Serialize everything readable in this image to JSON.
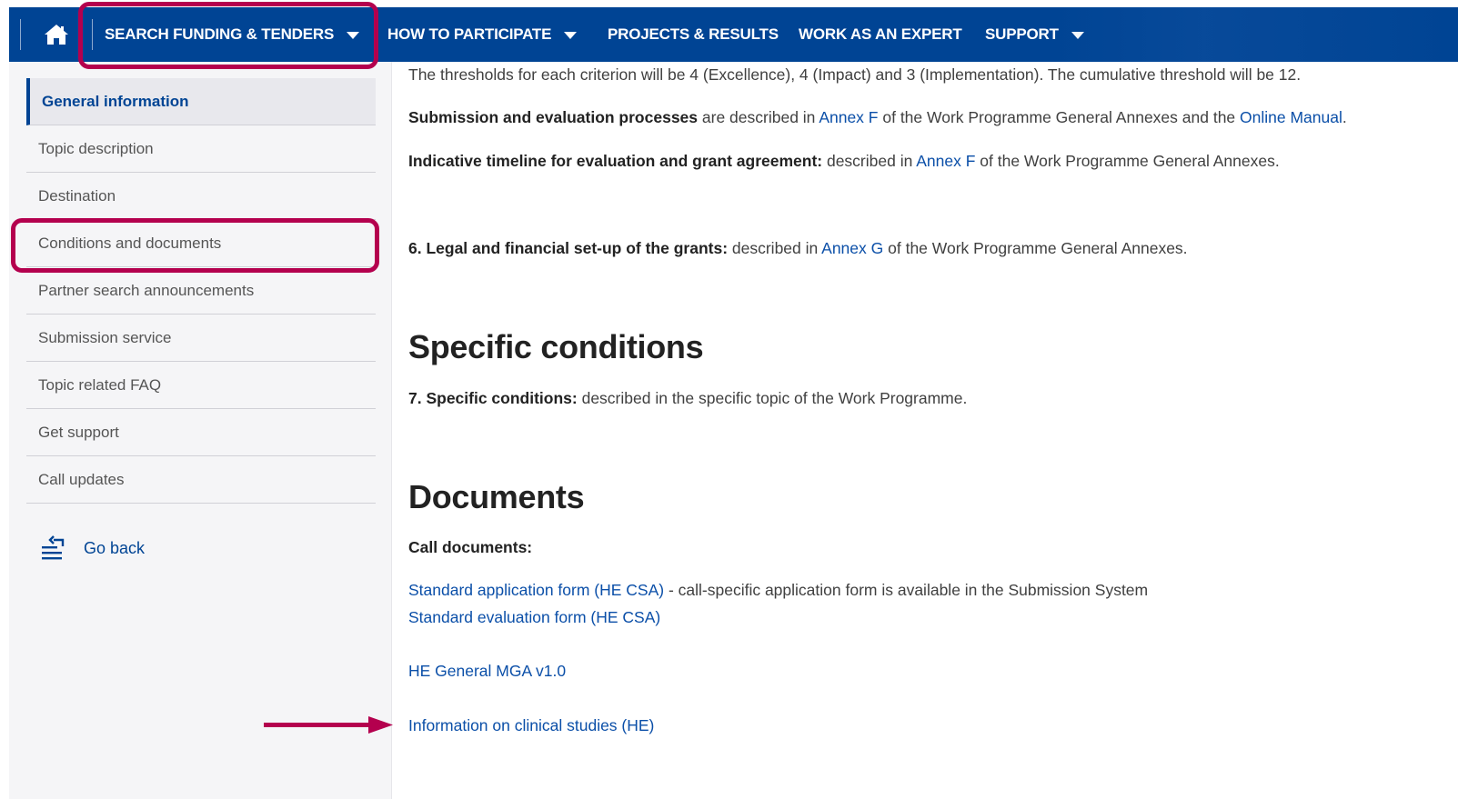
{
  "nav": {
    "items": [
      {
        "label": "SEARCH FUNDING & TENDERS"
      },
      {
        "label": "HOW TO PARTICIPATE"
      },
      {
        "label": "PROJECTS & RESULTS"
      },
      {
        "label": "WORK AS AN EXPERT"
      },
      {
        "label": "SUPPORT"
      }
    ],
    "home_icon": "home-icon",
    "caret_icon": "caret-down-icon",
    "background": "#004494"
  },
  "sidebar": {
    "items": [
      {
        "label": "General information"
      },
      {
        "label": "Topic description"
      },
      {
        "label": "Destination"
      },
      {
        "label": "Conditions and documents"
      },
      {
        "label": "Partner search announcements"
      },
      {
        "label": "Submission service"
      },
      {
        "label": "Topic related FAQ"
      },
      {
        "label": "Get support"
      },
      {
        "label": "Call updates"
      }
    ],
    "go_back": {
      "label": "Go back",
      "icon": "list-back-icon"
    }
  },
  "content": {
    "thresholds": "The thresholds for each criterion will be 4 (Excellence), 4 (Impact) and 3 (Implementation). The cumulative threshold will be 12.",
    "submission": {
      "bold": "Submission and evaluation processes",
      "text1": " are described in ",
      "link1": "Annex F",
      "text2": " of the Work Programme General Annexes and the ",
      "link2": "Online Manual",
      "text3": "."
    },
    "timeline": {
      "bold": "Indicative timeline for evaluation and grant agreement:",
      "text1": " described in ",
      "link1": "Annex F",
      "text2": " of the Work Programme General Annexes."
    },
    "legal": {
      "bold": "6. Legal and financial set-up of the grants:",
      "text1": " described in ",
      "link1": "Annex G",
      "text2": " of the Work Programme General Annexes."
    },
    "specific_heading": "Specific conditions",
    "specific": {
      "bold": "7. Specific conditions:",
      "text1": " described in the specific topic of the Work Programme."
    },
    "documents_heading": "Documents",
    "call_documents": "Call documents:",
    "std_app": {
      "link": "Standard application form (HE CSA)",
      "text": " - call-specific application form is available in the Submission System"
    },
    "std_eval": "Standard evaluation form (HE CSA)",
    "mga": "HE General MGA v1.0",
    "clinical": "Information on clinical studies (HE)"
  },
  "annotation_color": "#b4004e"
}
